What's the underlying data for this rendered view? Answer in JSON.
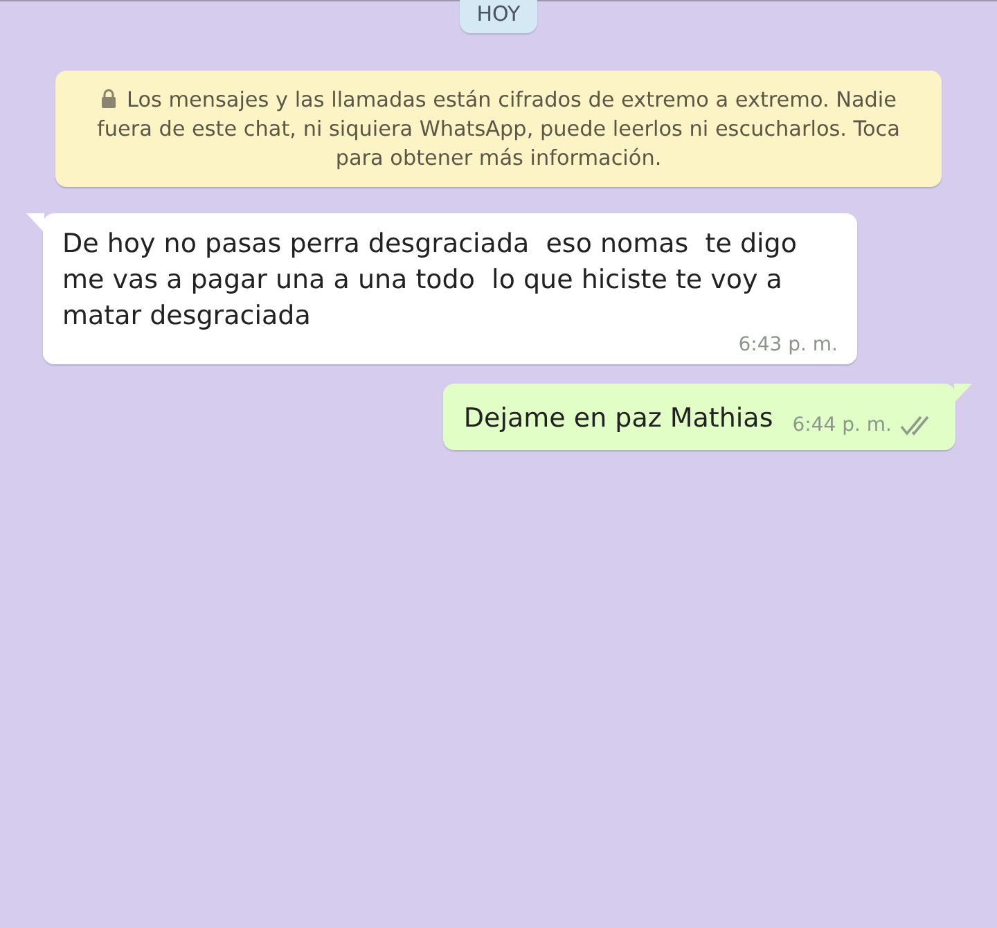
{
  "date_chip": "HOY",
  "encryption_notice": "Los mensajes y las llamadas están cifrados de extremo a extremo. Nadie fuera de este chat, ni siquiera WhatsApp, puede leerlos ni escucharlos. Toca para obtener más información.",
  "messages": [
    {
      "kind": "incoming",
      "text": "De hoy no pasas perra desgraciada  eso nomas  te digo me vas a pagar una a una todo  lo que hiciste te voy a matar desgraciada",
      "time": "6:43 p. m."
    },
    {
      "kind": "outgoing",
      "text": "Dejame en paz Mathias",
      "time": "6:44 p. m.",
      "read": false
    }
  ]
}
